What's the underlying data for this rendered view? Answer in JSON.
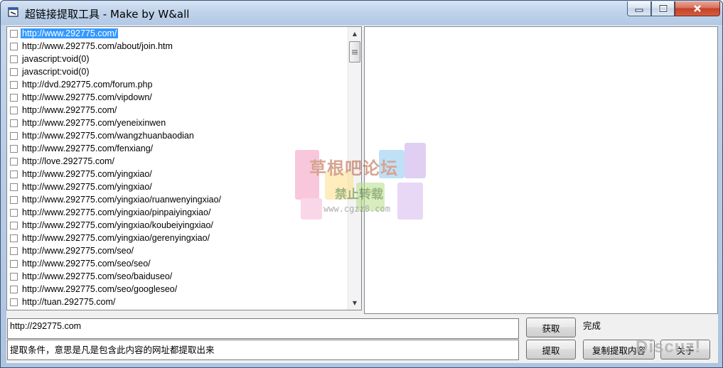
{
  "window": {
    "title": "超链接提取工具 - Make by W&all",
    "icon": "app-window-icon",
    "controls": [
      "minimize-icon",
      "maximize-icon",
      "close-icon"
    ]
  },
  "link_list": {
    "items": [
      {
        "url": "http://www.292775.com/",
        "checked": false,
        "selected": true
      },
      {
        "url": "http://www.292775.com/about/join.htm",
        "checked": false,
        "selected": false
      },
      {
        "url": "javascript:void(0)",
        "checked": false,
        "selected": false
      },
      {
        "url": "javascript:void(0)",
        "checked": false,
        "selected": false
      },
      {
        "url": "http://dvd.292775.com/forum.php",
        "checked": false,
        "selected": false
      },
      {
        "url": "http://www.292775.com/vipdown/",
        "checked": false,
        "selected": false
      },
      {
        "url": "http://www.292775.com/",
        "checked": false,
        "selected": false
      },
      {
        "url": "http://www.292775.com/yeneixinwen",
        "checked": false,
        "selected": false
      },
      {
        "url": "http://www.292775.com/wangzhuanbaodian",
        "checked": false,
        "selected": false
      },
      {
        "url": "http://www.292775.com/fenxiang/",
        "checked": false,
        "selected": false
      },
      {
        "url": "http://love.292775.com/",
        "checked": false,
        "selected": false
      },
      {
        "url": "http://www.292775.com/yingxiao/",
        "checked": false,
        "selected": false
      },
      {
        "url": "http://www.292775.com/yingxiao/",
        "checked": false,
        "selected": false
      },
      {
        "url": "http://www.292775.com/yingxiao/ruanwenyingxiao/",
        "checked": false,
        "selected": false
      },
      {
        "url": "http://www.292775.com/yingxiao/pinpaiyingxiao/",
        "checked": false,
        "selected": false
      },
      {
        "url": "http://www.292775.com/yingxiao/koubeiyingxiao/",
        "checked": false,
        "selected": false
      },
      {
        "url": "http://www.292775.com/yingxiao/gerenyingxiao/",
        "checked": false,
        "selected": false
      },
      {
        "url": "http://www.292775.com/seo/",
        "checked": false,
        "selected": false
      },
      {
        "url": "http://www.292775.com/seo/seo/",
        "checked": false,
        "selected": false
      },
      {
        "url": "http://www.292775.com/seo/baiduseo/",
        "checked": false,
        "selected": false
      },
      {
        "url": "http://www.292775.com/seo/googleseo/",
        "checked": false,
        "selected": false
      },
      {
        "url": "http://tuan.292775.com/",
        "checked": false,
        "selected": false
      }
    ]
  },
  "url_input": {
    "value": "http://292775.com"
  },
  "filter_input": {
    "value": "提取条件，意思是凡是包含此内容的网址都提取出来"
  },
  "buttons": {
    "fetch_label": "获取",
    "extract_label": "提取",
    "copy_label": "复制提取内容",
    "about_label": "关于"
  },
  "status": {
    "text": "完成"
  },
  "watermark": {
    "title": "草根吧论坛",
    "subtitle": "禁止转载",
    "url": "www.cgzz8.com"
  },
  "corner_watermark": {
    "text": "Discuz!"
  }
}
